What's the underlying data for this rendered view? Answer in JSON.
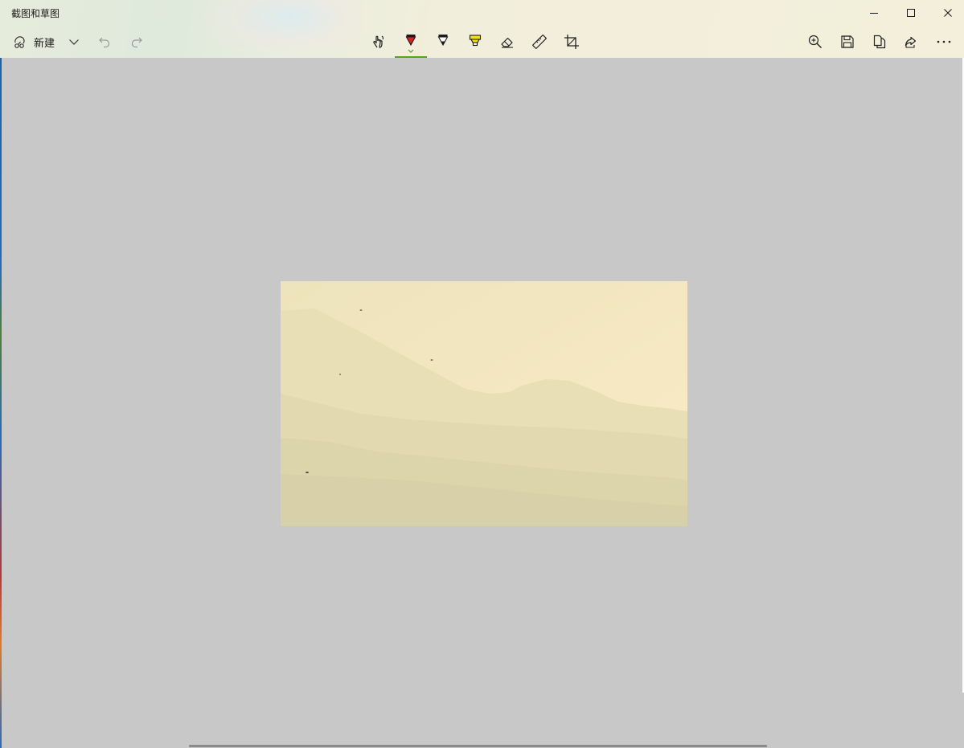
{
  "window": {
    "title": "截图和草图"
  },
  "toolbar": {
    "new_label": "新建"
  },
  "icons": {
    "minimize": "minimize-icon",
    "maximize": "maximize-icon",
    "close": "close-icon",
    "new": "snip-icon",
    "dropdown": "chevron-down-icon",
    "undo": "undo-icon",
    "redo": "redo-icon",
    "touch_writing": "touch-writing-icon",
    "ballpoint_pen": "ballpoint-pen-icon",
    "pencil": "pencil-icon",
    "highlighter": "highlighter-icon",
    "eraser": "eraser-icon",
    "ruler": "ruler-icon",
    "crop": "crop-icon",
    "zoom": "zoom-icon",
    "save": "save-icon",
    "copy": "copy-icon",
    "share": "share-icon",
    "more": "more-icon"
  },
  "colors": {
    "canvas_background": "#c8c8c8",
    "active_tool_underline": "#57a31f",
    "pen_red": "#e02020",
    "highlighter_yellow": "#f5e400"
  },
  "state": {
    "active_tool": "ballpoint-pen"
  }
}
